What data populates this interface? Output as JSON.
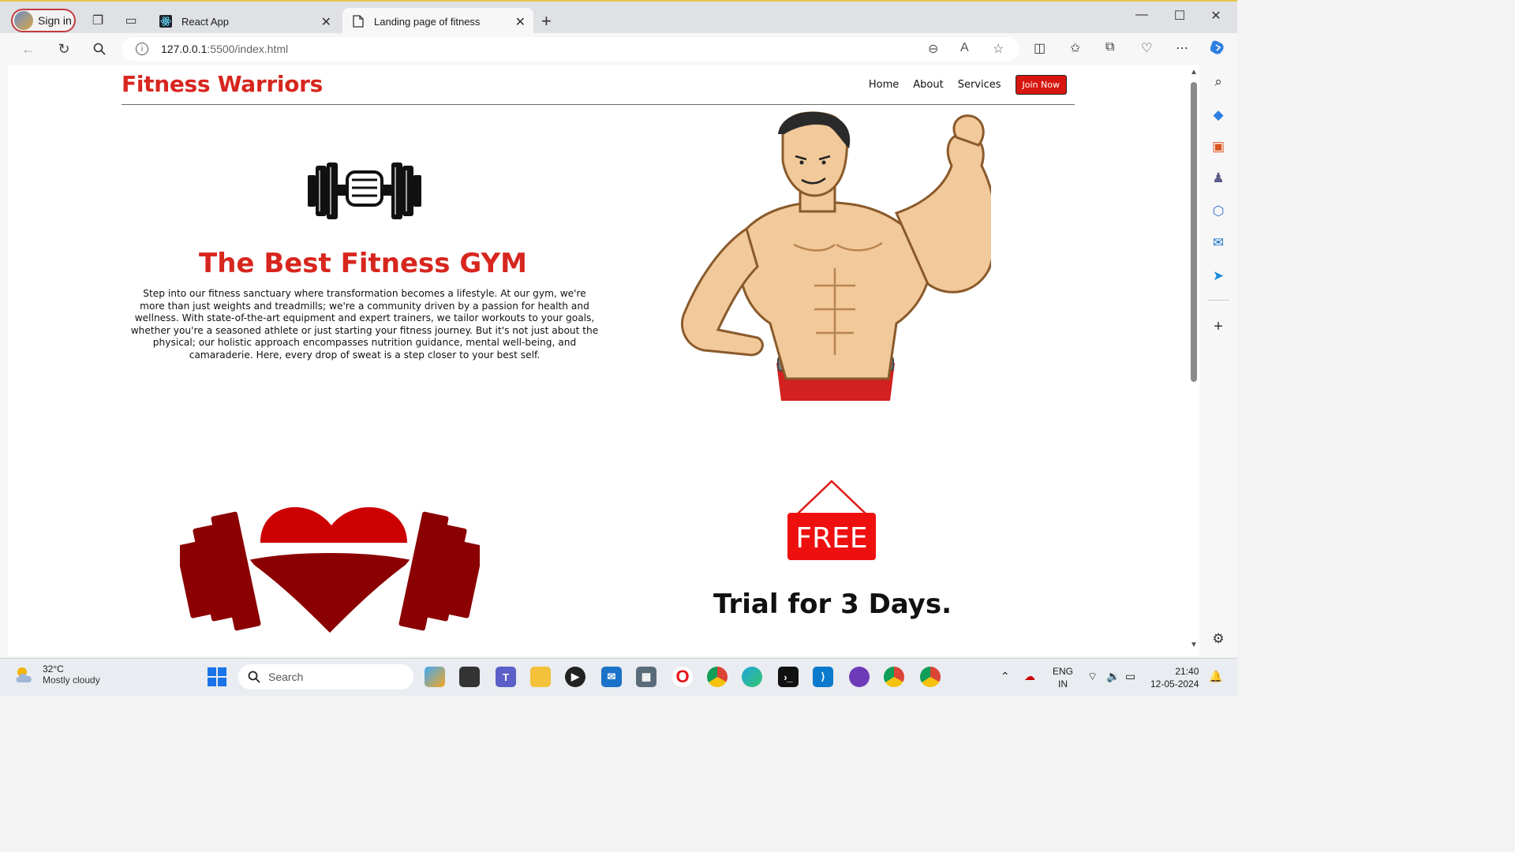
{
  "browser": {
    "signin_label": "Sign in",
    "tabs": [
      {
        "title": "React App",
        "active": false
      },
      {
        "title": "Landing page of fitness",
        "active": true
      }
    ],
    "url_host": "127.0.0.1",
    "url_path": ":5500/index.html"
  },
  "site": {
    "brand": "Fitness Warriors",
    "nav": [
      "Home",
      "About",
      "Services"
    ],
    "join_label": "Join Now",
    "hero_title": "The Best Fitness GYM",
    "hero_text": "Step into our fitness sanctuary where transformation becomes a lifestyle. At our gym, we're more than just weights and treadmills; we're a community driven by a passion for health and wellness. With state-of-the-art equipment and expert trainers, we tailor workouts to your goals, whether you're a seasoned athlete or just starting your fitness journey. But it's not just about the physical; our holistic approach encompasses nutrition guidance, mental well-being, and camaraderie. Here, every drop of sweat is a step closer to your best self.",
    "free_label": "FREE",
    "trial_text": "Trial for 3 Days."
  },
  "taskbar": {
    "temperature": "32°C",
    "weather": "Mostly cloudy",
    "search_placeholder": "Search",
    "lang": "ENG",
    "region": "IN",
    "time": "21:40",
    "date": "12-05-2024"
  },
  "colors": {
    "brand_red": "#d7261e",
    "button_red": "#d7160f",
    "dark_red": "#8b0000"
  }
}
